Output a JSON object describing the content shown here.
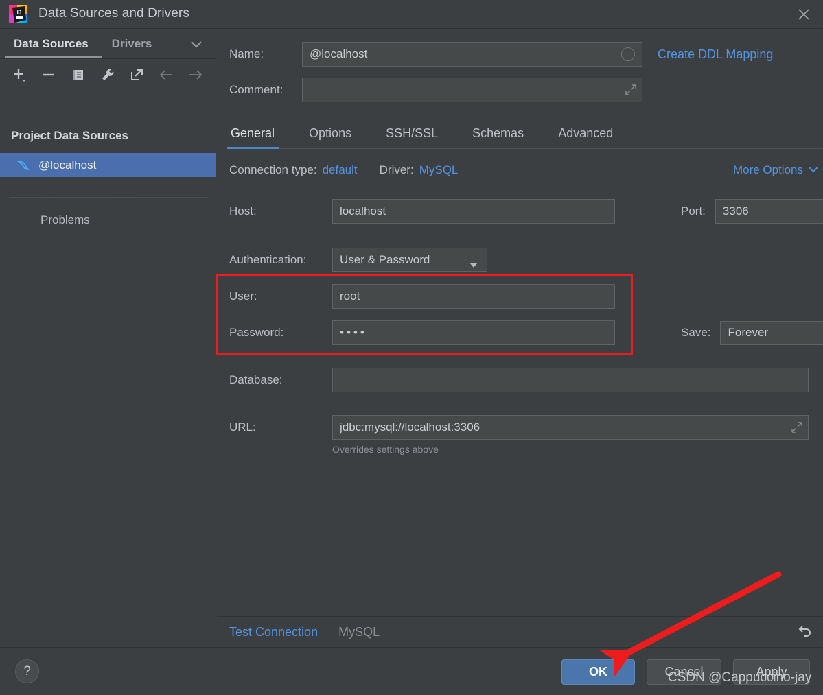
{
  "window": {
    "title": "Data Sources and Drivers",
    "logo_icon": "intellij-idea-logo",
    "close_icon": "close-icon"
  },
  "sidebar": {
    "tabs": [
      {
        "label": "Data Sources",
        "active": true
      },
      {
        "label": "Drivers",
        "active": false
      }
    ],
    "tabs_chevron_icon": "chevron-down-icon",
    "toolbar": [
      {
        "icon": "plus-icon",
        "name": "add-data-source-button"
      },
      {
        "icon": "minus-icon",
        "name": "remove-data-source-button"
      },
      {
        "icon": "copy-icon",
        "name": "duplicate-data-source-button"
      },
      {
        "icon": "wrench-icon",
        "name": "properties-button"
      },
      {
        "icon": "export-icon",
        "name": "share-button"
      },
      {
        "icon": "arrow-left-icon",
        "name": "navigate-back-button"
      },
      {
        "icon": "arrow-right-icon",
        "name": "navigate-forward-button"
      }
    ],
    "group_title": "Project Data Sources",
    "items": [
      {
        "label": "@localhost",
        "icon": "mysql-dolphin-icon",
        "selected": true
      }
    ],
    "problems_label": "Problems"
  },
  "detail": {
    "name": {
      "label": "Name:",
      "value": "@localhost",
      "placeholder": ""
    },
    "name_circle_icon": "circle-icon",
    "ddl_link": "Create DDL Mapping",
    "comment": {
      "label": "Comment:",
      "value": "",
      "placeholder": ""
    },
    "comment_expand_icon": "expand-icon",
    "tabs": [
      {
        "label": "General",
        "active": true
      },
      {
        "label": "Options",
        "active": false
      },
      {
        "label": "SSH/SSL",
        "active": false
      },
      {
        "label": "Schemas",
        "active": false
      },
      {
        "label": "Advanced",
        "active": false
      }
    ],
    "connection_type": {
      "label": "Connection type:",
      "value": "default"
    },
    "driver": {
      "label": "Driver:",
      "value": "MySQL"
    },
    "more_options": {
      "label": "More Options",
      "icon": "chevron-down-icon"
    },
    "host": {
      "label": "Host:",
      "value": "localhost"
    },
    "port": {
      "label": "Port:",
      "value": "3306"
    },
    "authentication": {
      "label": "Authentication:",
      "value": "User & Password",
      "caret_icon": "caret-down-icon"
    },
    "user": {
      "label": "User:",
      "value": "root"
    },
    "password": {
      "label": "Password:",
      "value": "••••"
    },
    "save": {
      "label": "Save:",
      "value": "Forever",
      "caret_icon": "caret-down-icon"
    },
    "database": {
      "label": "Database:",
      "value": ""
    },
    "url": {
      "label": "URL:",
      "value": "jdbc:mysql://localhost:3306"
    },
    "url_expand_icon": "expand-icon",
    "url_hint": "Overrides settings above",
    "test_connection": "Test Connection",
    "driver_status": "MySQL",
    "revert_icon": "revert-icon"
  },
  "footer": {
    "help_label": "?",
    "ok_label": "OK",
    "cancel_label": "Cancel",
    "apply_label": "Apply"
  },
  "annotations": {
    "watermark": "CSDN @Cappuccino-jay",
    "highlight_color": "#ee1c1c",
    "arrow_color": "#ee1c1c",
    "accent_color": "#4a76ab",
    "link_color": "#5294e2",
    "selection_color": "#4b6eaf"
  }
}
